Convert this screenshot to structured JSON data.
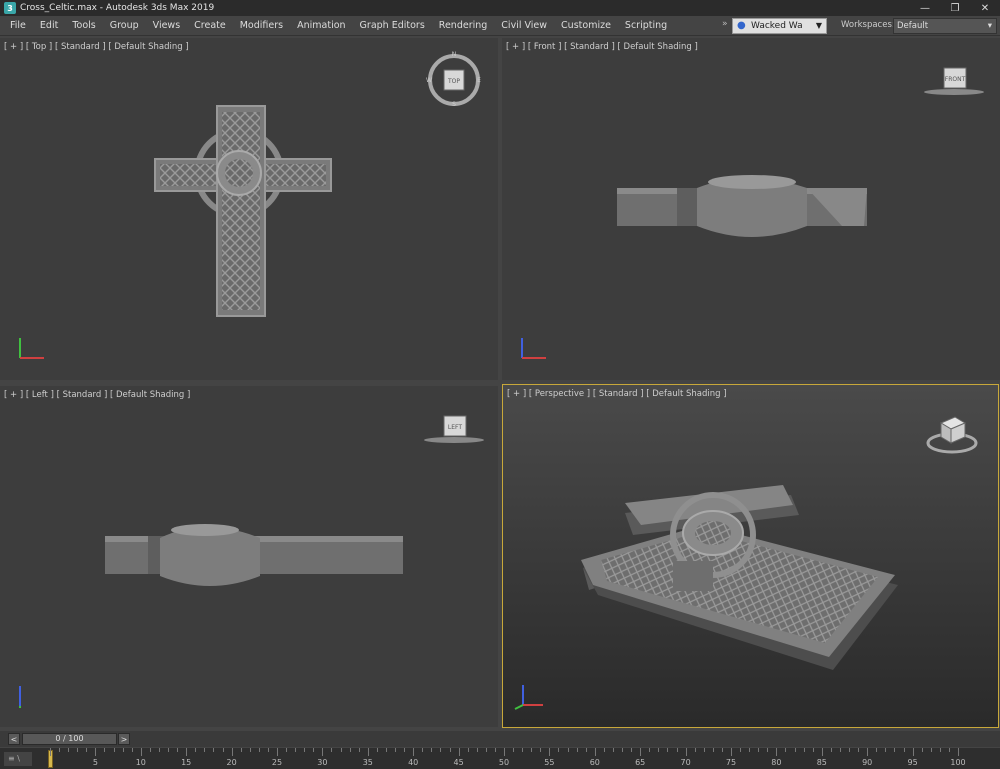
{
  "titlebar": {
    "title": "Cross_Celtic.max - Autodesk 3ds Max 2019",
    "minimize": "—",
    "restore": "❐",
    "close": "✕"
  },
  "menubar": {
    "items": [
      "File",
      "Edit",
      "Tools",
      "Group",
      "Views",
      "Create",
      "Modifiers",
      "Animation",
      "Graph Editors",
      "Rendering",
      "Civil View",
      "Customize",
      "Scripting"
    ],
    "overflow_icon": "»",
    "user_name": "Wacked Wa",
    "workspaces_label": "Workspaces:",
    "workspace_value": "Default"
  },
  "viewports": [
    {
      "label": "[ + ] [ Top ] [ Standard ] [ Default Shading ]",
      "navcube_label": "TOP",
      "compass": [
        "N",
        "E",
        "S",
        "W"
      ]
    },
    {
      "label": "[ + ] [ Front ] [ Standard ] [ Default Shading ]",
      "navcube_label": "FRONT"
    },
    {
      "label": "[ + ] [ Left ] [ Standard ] [ Default Shading ]",
      "navcube_label": "LEFT"
    },
    {
      "label": "[ + ] [ Perspective ] [ Standard ] [ Default Shading ]",
      "navcube_label": ""
    }
  ],
  "timeslider": {
    "frame_text": "0 / 100",
    "prev": "<",
    "next": ">"
  },
  "trackbar": {
    "corner": "≡ \\",
    "ticks": [
      "0",
      "5",
      "10",
      "15",
      "20",
      "25",
      "30",
      "35",
      "40",
      "45",
      "50",
      "55",
      "60",
      "65",
      "70",
      "75",
      "80",
      "85",
      "90",
      "95",
      "100"
    ]
  },
  "colors": {
    "viewport_bg": "#3d3d3d",
    "active_border": "#c8a83a",
    "axis_x": "#d04040",
    "axis_y": "#40c040",
    "axis_z": "#4060e0"
  }
}
